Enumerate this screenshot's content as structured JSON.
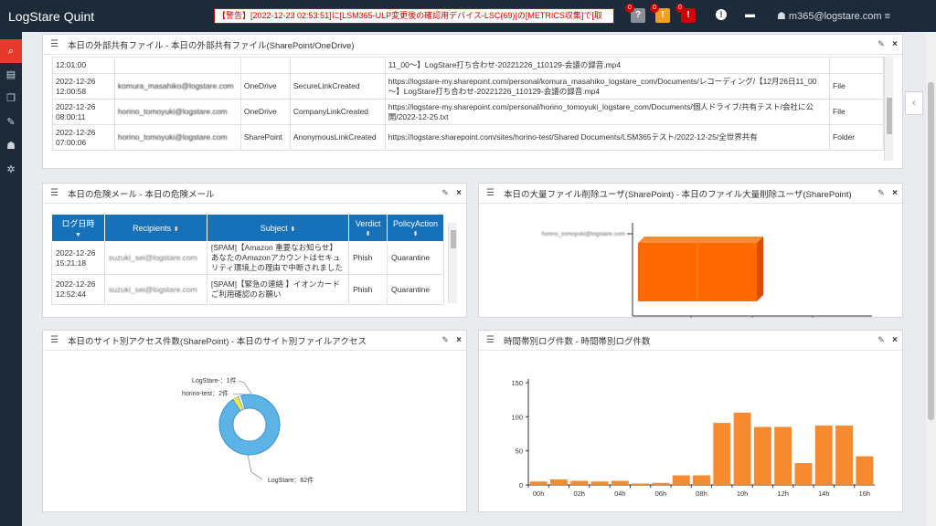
{
  "app": {
    "title": "LogStare Quint",
    "alert_text": "【警告】[2022-12-23 02:53:51]に[LSM365-ULP変更後の確認用デバイス-LSC(69)]の[METRICS収集]で[取",
    "indicator_counts": [
      "0",
      "0",
      "0"
    ],
    "user": "m365@logstare.com"
  },
  "sidebar": {
    "items": [
      {
        "name": "search-icon",
        "glyph": "🔍"
      },
      {
        "name": "dashboard-icon",
        "glyph": "▤"
      },
      {
        "name": "book-icon",
        "glyph": "❐"
      },
      {
        "name": "wrench-icon",
        "glyph": "✎"
      },
      {
        "name": "users-icon",
        "glyph": "☗"
      },
      {
        "name": "gears-icon",
        "glyph": "✲"
      }
    ]
  },
  "panel_share": {
    "title": "本日の外部共有ファイル - 本日の外部共有ファイル(SharePoint/OneDrive)",
    "rows": [
      {
        "time": "12:01:00",
        "user": "",
        "service": "",
        "op": "",
        "path": "11_00～】LogStare打ち合わせ-20221226_110129-会議の録音.mp4",
        "type": ""
      },
      {
        "time": "2022-12-26 12:00:58",
        "user": "komura_masahiko@logstare.com",
        "service": "OneDrive",
        "op": "SecureLinkCreated",
        "path": "https://logstare-my.sharepoint.com/personal/komura_masahiko_logstare_com/Documents/レコーディング/【12月26日11_00～】LogStare打ち合わせ-20221226_110129-会議の録音.mp4",
        "type": "File"
      },
      {
        "time": "2022-12-26 08:00:11",
        "user": "horino_tomoyuki@logstare.com",
        "service": "OneDrive",
        "op": "CompanyLinkCreated",
        "path": "https://logstare-my.sharepoint.com/personal/horino_tomoyuki_logstare_com/Documents/個人ドライブ/共有テスト/会社に公開/2022-12-25.txt",
        "type": "File"
      },
      {
        "time": "2022-12-26 07:00:06",
        "user": "horino_tomoyuki@logstare.com",
        "service": "SharePoint",
        "op": "AnonymousLinkCreated",
        "path": "https://logstare.sharepoint.com/sites/horino-test/Shared Documents/LSM365テスト/2022-12-25/全世界共有",
        "type": "Folder"
      }
    ]
  },
  "panel_mail": {
    "title": "本日の危険メール - 本日の危険メール",
    "headers": [
      "ログ日時",
      "Recipients",
      "Subject",
      "Verdict",
      "PolicyAction"
    ],
    "rows": [
      {
        "time": "2022-12-26 15:21:18",
        "recipient": "suzuki_sei@logstare.com",
        "subject": "[SPAM]【Amazon 重要なお知らせ】あなたのAmazonアカウントはセキュリティ環境上の理由で中断されました",
        "verdict": "Phish",
        "action": "Quarantine"
      },
      {
        "time": "2022-12-26 12:52:44",
        "recipient": "suzuki_sei@logstare.com",
        "subject": "[SPAM]【緊急の連絡 】イオンカードご利用確認のお願い",
        "verdict": "Phish",
        "action": "Quarantine"
      }
    ]
  },
  "panel_delete": {
    "title": "本日の大量ファイル削除ユーザ(SharePoint) - 本日のファイル大量削除ユーザ(SharePoint)"
  },
  "panel_site": {
    "title": "本日のサイト別アクセス件数(SharePoint) - 本日のサイト別ファイルアクセス"
  },
  "panel_hourly": {
    "title": "時間帯別ログ件数 - 時間帯別ログ件数"
  },
  "chart_data": [
    {
      "type": "bar",
      "categories": [
        "horino_tomoyuki@logstare.com"
      ],
      "values": [
        1
      ],
      "title": "",
      "orientation": "horizontal"
    },
    {
      "type": "pie",
      "categories": [
        "LogStare",
        "horino-test",
        "LogStare-"
      ],
      "values": [
        62,
        2,
        1
      ],
      "labels": [
        "LogStare：62件",
        "horino-test：2件",
        "LogStare-：1件"
      ],
      "colors": [
        "#5cb3e6",
        "#f5e642",
        "#eeeeee"
      ],
      "donut": true
    },
    {
      "type": "bar",
      "categories": [
        "00h",
        "01h",
        "02h",
        "03h",
        "04h",
        "05h",
        "06h",
        "07h",
        "08h",
        "09h",
        "10h",
        "11h",
        "12h",
        "13h",
        "14h",
        "15h",
        "16h"
      ],
      "tick_labels": [
        "00h",
        "02h",
        "04h",
        "06h",
        "08h",
        "10h",
        "12h",
        "14h",
        "16h"
      ],
      "values": [
        5,
        8,
        6,
        5,
        6,
        2,
        3,
        14,
        14,
        91,
        106,
        85,
        85,
        32,
        87,
        87,
        42
      ],
      "ylim": [
        0,
        150
      ],
      "yticks": [
        0,
        50,
        100,
        150
      ],
      "color": "#f58a30"
    }
  ]
}
